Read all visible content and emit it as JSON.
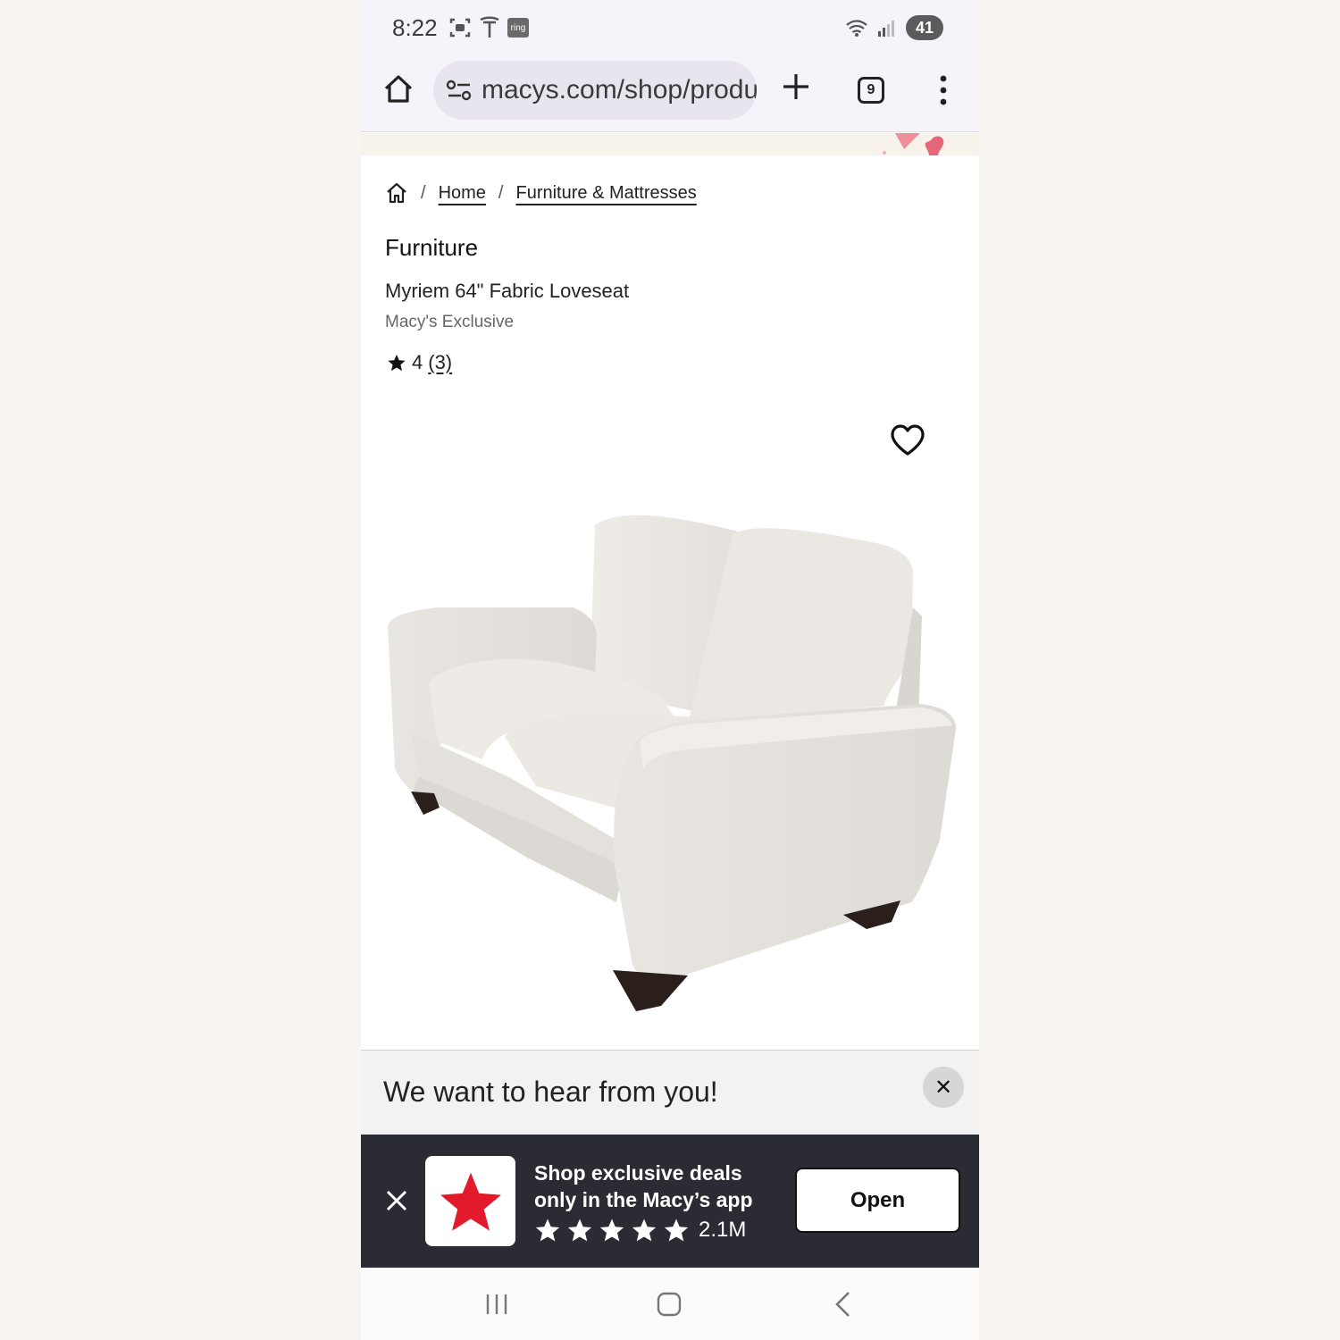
{
  "status_bar": {
    "time": "8:22",
    "ring_label": "ring",
    "battery": "41"
  },
  "browser": {
    "url": "macys.com/shop/product/myriem",
    "tab_count": "9"
  },
  "breadcrumb": {
    "home": "Home",
    "furniture_mattresses": "Furniture & Mattresses",
    "separator": "/"
  },
  "product": {
    "category": "Furniture",
    "name": "Myriem 64\" Fabric Loveseat",
    "brand": "Macy's Exclusive",
    "rating": "4",
    "review_count": "(3)"
  },
  "survey": {
    "title": "We want to hear from you!",
    "close": "✕"
  },
  "app_banner": {
    "line1": "Shop exclusive deals",
    "line2": "only in the Macy’s app",
    "rating_count": "2.1M",
    "stars": 5,
    "open_label": "Open",
    "logo_color": "#e21a2c"
  },
  "colors": {
    "status_bg": "#f6f4fb",
    "banner_bg": "#2b2b33",
    "sofa": "#ece9e5"
  }
}
